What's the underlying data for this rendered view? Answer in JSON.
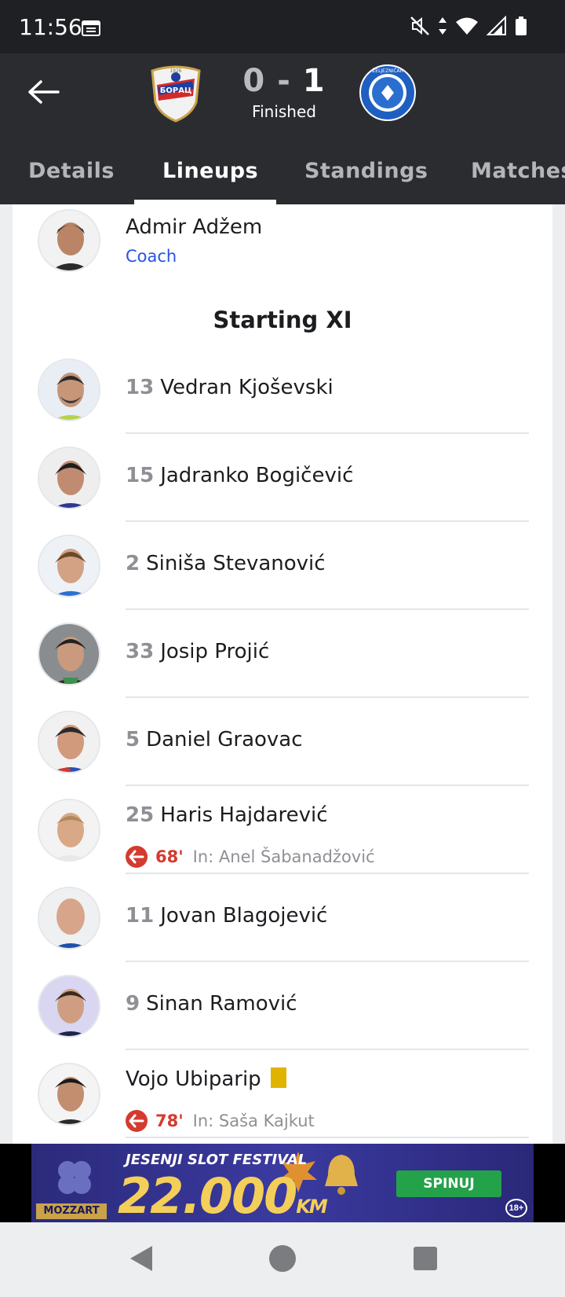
{
  "status_bar": {
    "time": "11:56",
    "icons": [
      "calendar-icon",
      "mute-icon",
      "data-arrows-icon",
      "wifi-icon",
      "signal-icon",
      "battery-icon"
    ]
  },
  "match": {
    "home_score": "0",
    "separator": "-",
    "away_score": "1",
    "status": "Finished",
    "home_logo_text": "БОРАЦ",
    "home_logo_year": "1926",
    "away_logo_text": "ŽELJEZNIČAR"
  },
  "tabs": [
    {
      "label": "Details"
    },
    {
      "label": "Lineups"
    },
    {
      "label": "Standings"
    },
    {
      "label": "Matches"
    }
  ],
  "active_tab": "Lineups",
  "coach": {
    "name": "Admir Adžem",
    "role": "Coach"
  },
  "section_title": "Starting XI",
  "players": [
    {
      "number": "13",
      "name": "Vedran Kjoševski"
    },
    {
      "number": "15",
      "name": "Jadranko Bogičević"
    },
    {
      "number": "2",
      "name": "Siniša Stevanović"
    },
    {
      "number": "33",
      "name": "Josip Projić"
    },
    {
      "number": "5",
      "name": "Daniel Graovac"
    },
    {
      "number": "25",
      "name": "Haris Hajdarević",
      "sub_minute": "68'",
      "sub_text": "In: Anel Šabanadžović"
    },
    {
      "number": "11",
      "name": "Jovan Blagojević"
    },
    {
      "number": "9",
      "name": "Sinan Ramović"
    },
    {
      "number": "",
      "name": "Vojo Ubiparip",
      "sub_minute": "78'",
      "sub_text": "In: Saša Kajkut",
      "card": "yellow"
    }
  ],
  "ad": {
    "title": "JESENJI SLOT FESTIVAL",
    "amount": "22.000",
    "currency": "KM",
    "brand": "MOZZART",
    "button": "SPINUJ",
    "age": "18+"
  },
  "colors": {
    "header_bg": "#2a2c30",
    "accent_blue": "#2952e3",
    "sub_red": "#d43a2f",
    "yellow_card": "#e0b300"
  }
}
